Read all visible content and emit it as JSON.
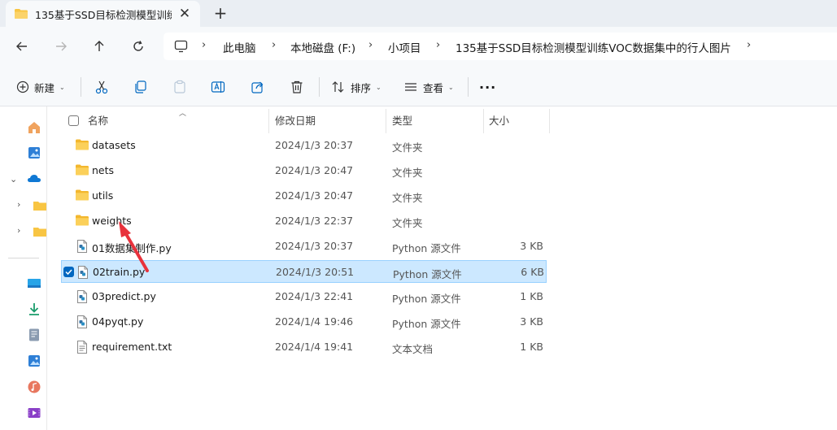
{
  "tab": {
    "title": "135基于SSD目标检测模型训练\\",
    "close_glyph": "✕",
    "new_glyph": "+"
  },
  "breadcrumb": [
    "此电脑",
    "本地磁盘 (F:)",
    "小项目",
    "135基于SSD目标检测模型训练VOC数据集中的行人图片"
  ],
  "toolbar": {
    "new_label": "新建",
    "sort_label": "排序",
    "view_label": "查看",
    "more_label": "···"
  },
  "columns": {
    "name": "名称",
    "date": "修改日期",
    "type": "类型",
    "size": "大小"
  },
  "files": [
    {
      "name": "datasets",
      "date": "2024/1/3 20:37",
      "type": "文件夹",
      "size": "",
      "kind": "folder"
    },
    {
      "name": "nets",
      "date": "2024/1/3 20:47",
      "type": "文件夹",
      "size": "",
      "kind": "folder"
    },
    {
      "name": "utils",
      "date": "2024/1/3 20:47",
      "type": "文件夹",
      "size": "",
      "kind": "folder"
    },
    {
      "name": "weights",
      "date": "2024/1/3 22:37",
      "type": "文件夹",
      "size": "",
      "kind": "folder"
    },
    {
      "name": "01数据集制作.py",
      "date": "2024/1/3 20:37",
      "type": "Python 源文件",
      "size": "3 KB",
      "kind": "python"
    },
    {
      "name": "02train.py",
      "date": "2024/1/3 20:51",
      "type": "Python 源文件",
      "size": "6 KB",
      "kind": "python",
      "selected": true
    },
    {
      "name": "03predict.py",
      "date": "2024/1/3 22:41",
      "type": "Python 源文件",
      "size": "1 KB",
      "kind": "python"
    },
    {
      "name": "04pyqt.py",
      "date": "2024/1/4 19:46",
      "type": "Python 源文件",
      "size": "3 KB",
      "kind": "python"
    },
    {
      "name": "requirement.txt",
      "date": "2024/1/4 19:41",
      "type": "文本文档",
      "size": "1 KB",
      "kind": "text"
    }
  ],
  "colors": {
    "accent": "#0067c0",
    "selection": "#cce8ff",
    "folder": "#f8c543",
    "annotation_arrow": "#e8323c"
  }
}
